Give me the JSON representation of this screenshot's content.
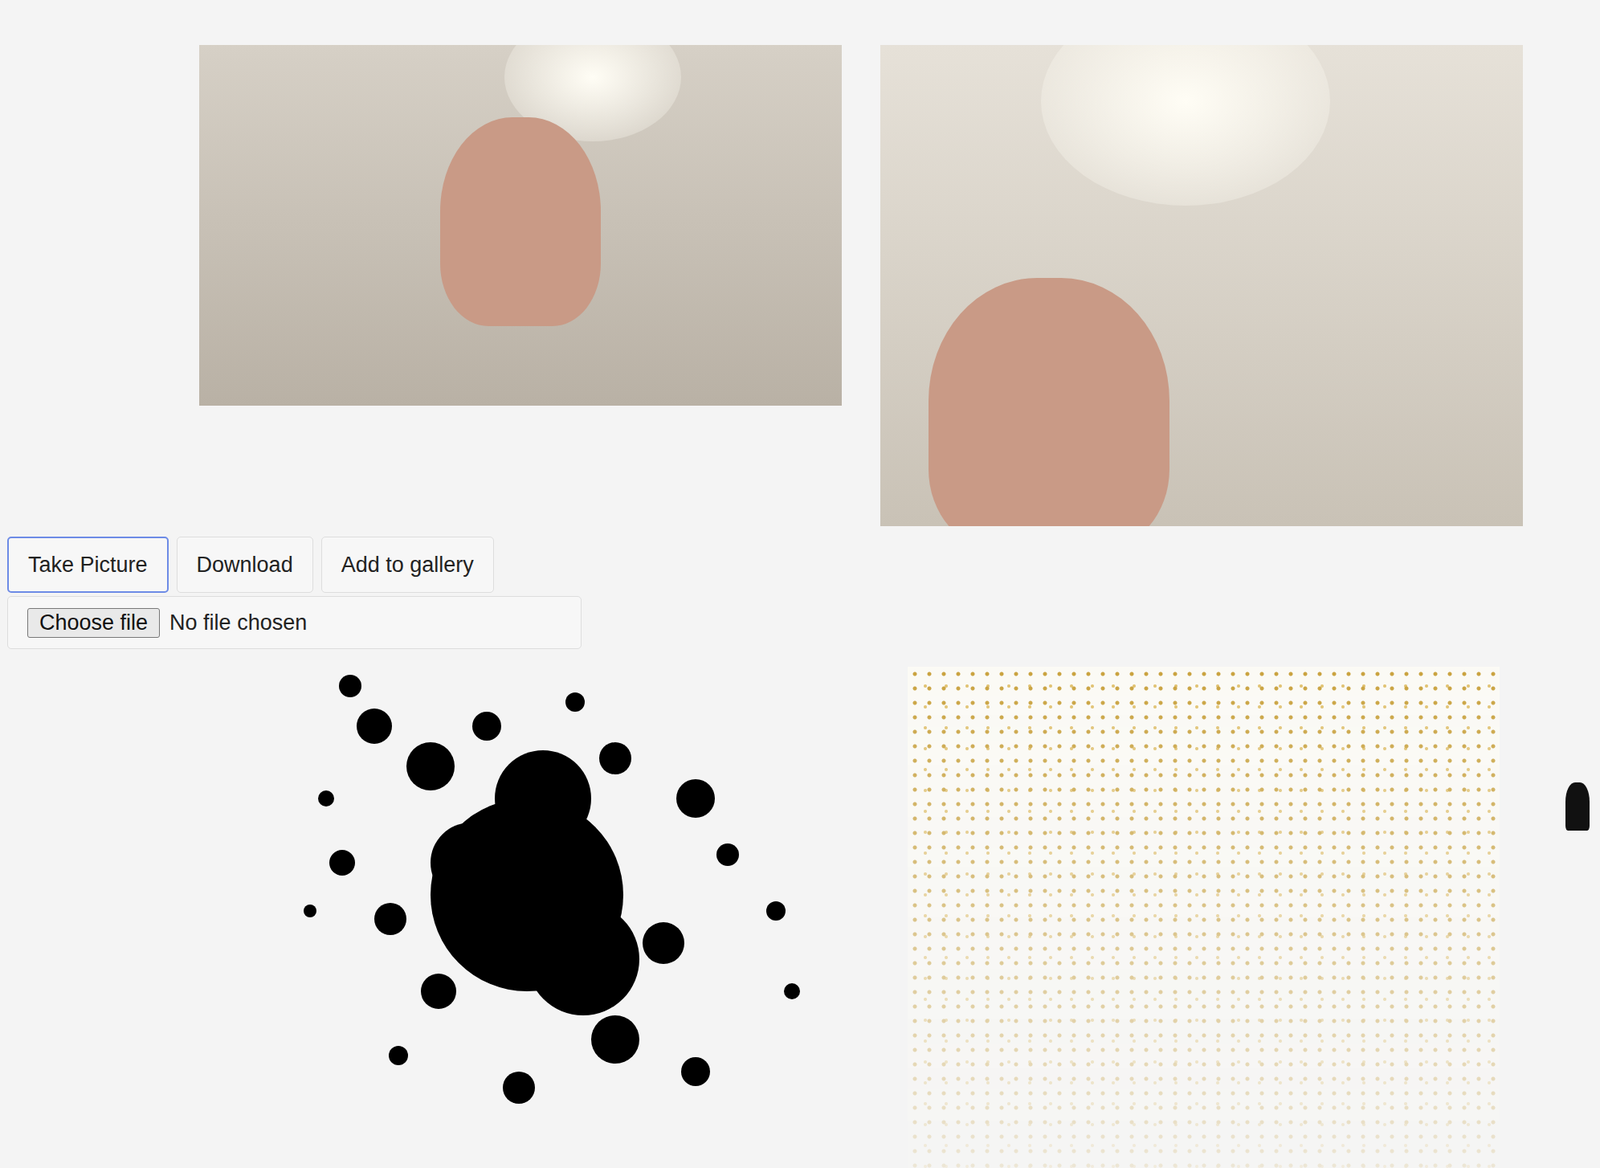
{
  "videos": [
    {
      "name": "live-camera"
    },
    {
      "name": "snapshot"
    }
  ],
  "buttons": [
    {
      "label": "Take Picture",
      "focused": true
    },
    {
      "label": "Download",
      "focused": false
    },
    {
      "label": "Add to gallery",
      "focused": false
    }
  ],
  "file_input": {
    "button": "Choose file",
    "status": "No file chosen"
  },
  "stickers": [
    {
      "name": "ink-splat"
    },
    {
      "name": "gold-stars"
    }
  ]
}
